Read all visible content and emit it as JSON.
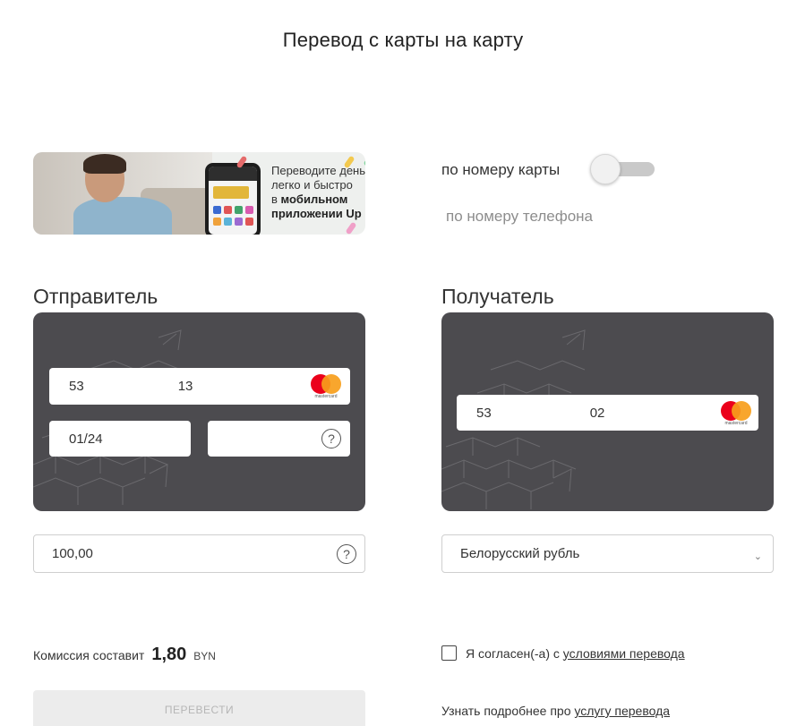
{
  "page": {
    "title": "Перевод с карты на карту"
  },
  "banner": {
    "line1": "Переводите деньги",
    "line2": "легко и быстро",
    "line3_prefix": "в ",
    "line3_bold": "мобильном",
    "line4": "приложении Up"
  },
  "mode": {
    "by_card_label": "по номеру карты",
    "by_phone_label": "по номеру телефона",
    "toggle_state": "off"
  },
  "sender": {
    "title": "Отправитель",
    "card_number_start": "53",
    "card_number_end": "13",
    "expiry": "01/24",
    "cvv_help": "?",
    "card_brand": "mastercard"
  },
  "amount": {
    "value": "100,00",
    "help": "?"
  },
  "recipient": {
    "title": "Получатель",
    "card_number_start": "53",
    "card_number_end": "02",
    "card_brand": "mastercard"
  },
  "currency": {
    "selected": "Белорусский рубль",
    "chevron": "⌄"
  },
  "fee": {
    "label": "Комиссия составит",
    "amount": "1,80",
    "currency": "BYN"
  },
  "agreement": {
    "prefix": "Я согласен(-а) с ",
    "link": "условиями перевода",
    "checked": false
  },
  "submit": {
    "label": "ПЕРЕВЕСТИ"
  },
  "more_info": {
    "prefix": "Узнать подробнее про ",
    "link": "услугу перевода"
  },
  "colors": {
    "card_bg": "#4c4b4f",
    "mc_red": "#eb001b",
    "mc_orange": "#f79e1b"
  }
}
